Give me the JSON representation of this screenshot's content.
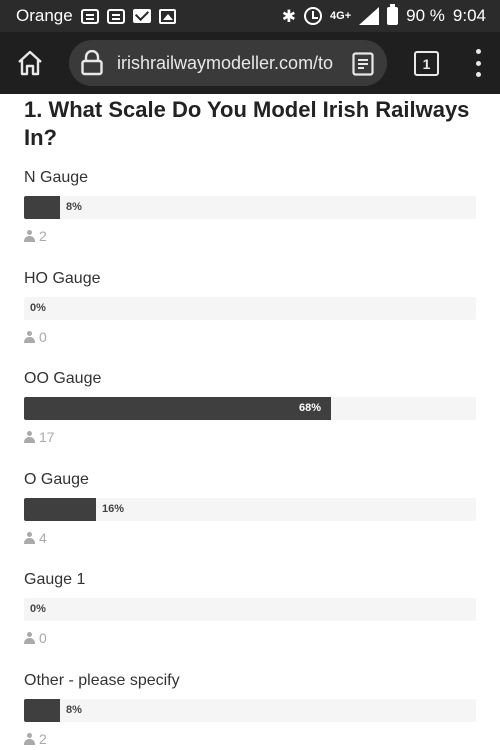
{
  "status_bar": {
    "carrier": "Orange",
    "network": "4G+",
    "battery": "90 %",
    "time": "9:04"
  },
  "browser": {
    "url": "irishrailwaymodeller.com/to",
    "tab_count": "1"
  },
  "poll": {
    "question": "1. What Scale Do You Model Irish Railways In?",
    "options": [
      {
        "label": "N Gauge",
        "percent_text": "8%",
        "percent": 8,
        "votes": "2"
      },
      {
        "label": "HO Gauge",
        "percent_text": "0%",
        "percent": 0,
        "votes": "0"
      },
      {
        "label": "OO Gauge",
        "percent_text": "68%",
        "percent": 68,
        "votes": "17"
      },
      {
        "label": "O Gauge",
        "percent_text": "16%",
        "percent": 16,
        "votes": "4"
      },
      {
        "label": "Gauge 1",
        "percent_text": "0%",
        "percent": 0,
        "votes": "0"
      },
      {
        "label": "Other - please specify",
        "percent_text": "8%",
        "percent": 8,
        "votes": "2"
      }
    ]
  },
  "colors": {
    "bar_fill": "#3f3f3f",
    "bar_track": "#f5f5f5",
    "toolbar_bg": "#1f1f1f",
    "status_bg": "#2b2b2b"
  }
}
